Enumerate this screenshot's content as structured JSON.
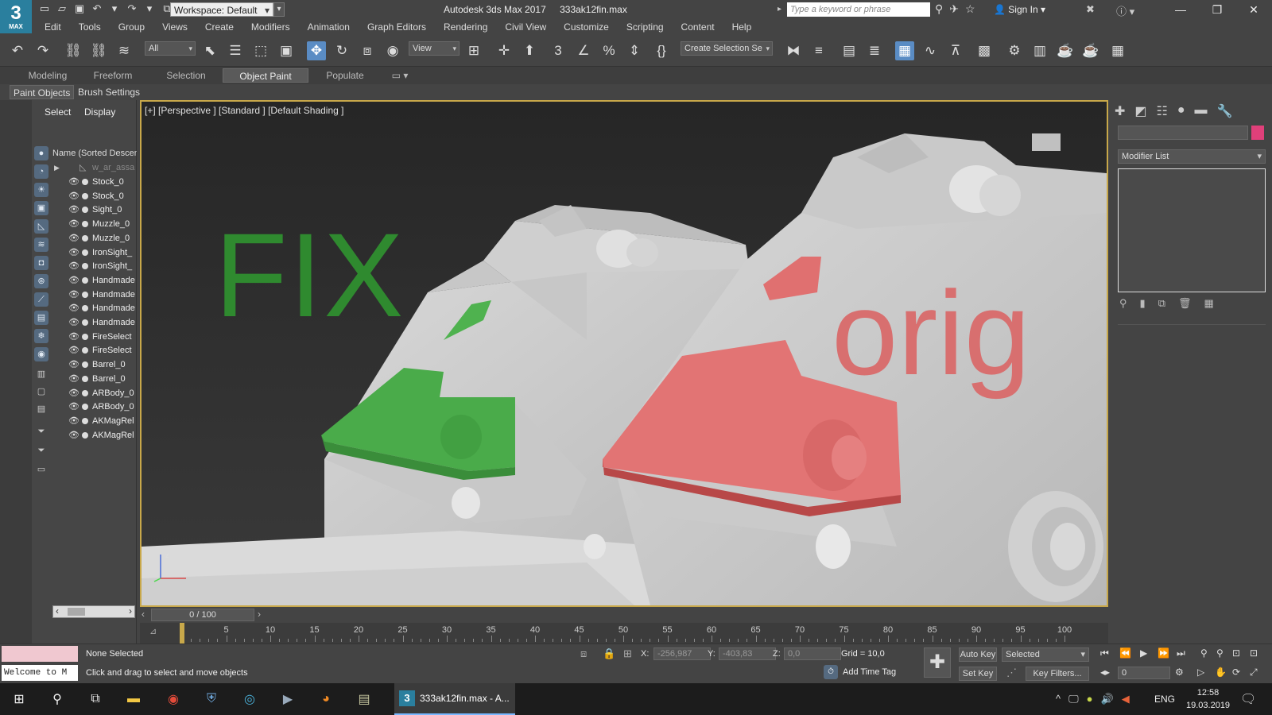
{
  "titlebar": {
    "logo_big": "3",
    "logo_small": "MAX",
    "workspace": "Workspace: Default",
    "app_name": "Autodesk 3ds Max 2017",
    "file_name": "333ak12fin.max",
    "search_placeholder": "Type a keyword or phrase",
    "sign_in": "Sign In"
  },
  "menu": [
    "Edit",
    "Tools",
    "Group",
    "Views",
    "Create",
    "Modifiers",
    "Animation",
    "Graph Editors",
    "Rendering",
    "Civil View",
    "Customize",
    "Scripting",
    "Content",
    "Help"
  ],
  "toolbar": {
    "filter_combo": "All",
    "view_combo": "View",
    "selection_set": "Create Selection Se"
  },
  "ribbon": {
    "tabs": [
      "Modeling",
      "Freeform",
      "Selection",
      "Object Paint",
      "Populate"
    ],
    "active_tab": "Object Paint",
    "subtabs": [
      "Paint Objects",
      "Brush Settings"
    ]
  },
  "explorer": {
    "tabs": [
      "Select",
      "Display"
    ],
    "header": "Name (Sorted Descen",
    "root": "w_ar_assa",
    "items": [
      "Stock_0",
      "Stock_0",
      "Sight_0",
      "Muzzle_0",
      "Muzzle_0",
      "IronSight_",
      "IronSight_",
      "Handmade",
      "Handmade",
      "Handmade",
      "Handmade",
      "FireSelect",
      "FireSelect",
      "Barrel_0",
      "Barrel_0",
      "ARBody_0",
      "ARBody_0",
      "AKMagRel",
      "AKMagRel"
    ]
  },
  "viewport": {
    "label": "[+] [Perspective ] [Standard ] [Default Shading ]",
    "fix_text": "FIX",
    "orig_text": "orig",
    "axis_z": "z",
    "colors": {
      "fix": "#3c9a3c",
      "orig": "#d86f6f",
      "frame": "#c8a84a"
    }
  },
  "command_panel": {
    "modifier_list": "Modifier List"
  },
  "timeline": {
    "slider": "0 / 100",
    "ticks": [
      5,
      10,
      15,
      20,
      25,
      30,
      35,
      40,
      45,
      50,
      55,
      60,
      65,
      70,
      75,
      80,
      85,
      90,
      95,
      100
    ]
  },
  "status": {
    "welcome": "Welcome to M",
    "selection": "None Selected",
    "hint": "Click and drag to select and move objects",
    "x_label": "X:",
    "x_value": "-256,987",
    "y_label": "Y:",
    "y_value": "-403,83",
    "z_label": "Z:",
    "z_value": "0,0",
    "grid": "Grid = 10,0",
    "add_time_tag": "Add Time Tag",
    "auto_key": "Auto Key",
    "set_key": "Set Key",
    "selected_combo": "Selected",
    "key_filters": "Key Filters...",
    "frame": "0"
  },
  "taskbar": {
    "active_task": "333ak12fin.max - A...",
    "language": "ENG",
    "time": "12:58",
    "date": "19.03.2019"
  }
}
